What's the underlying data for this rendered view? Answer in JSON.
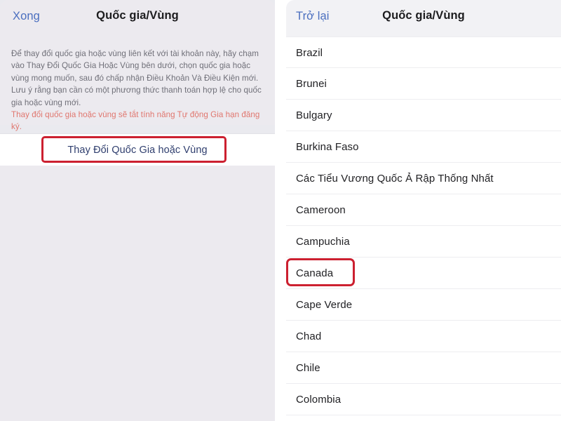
{
  "left_panel": {
    "header": {
      "done_label": "Xong",
      "title": "Quốc gia/Vùng"
    },
    "description": "Để thay đổi quốc gia hoặc vùng liên kết với tài khoản này, hãy chạm vào Thay Đổi Quốc Gia Hoặc Vùng bên dưới, chọn quốc gia hoặc vùng mong muốn, sau đó chấp nhận Điều Khoản Và Điều Kiện mới. Lưu ý rằng bạn cần có một phương thức thanh toán hợp lệ cho quốc gia hoặc vùng mới.",
    "warning": "Thay đổi quốc gia hoặc vùng sẽ tắt tính năng Tự động Gia hạn đăng ký.",
    "change_button_label": "Thay Đổi Quốc Gia hoặc Vùng",
    "highlight_color": "#cc2030",
    "warning_color": "#e0766e",
    "link_color": "#4b6fbf",
    "background_color": "#eceaef"
  },
  "right_panel": {
    "header": {
      "back_label": "Trở lại",
      "title": "Quốc gia/Vùng"
    },
    "highlighted_item": "Canada",
    "highlight_color": "#cc2030",
    "countries": [
      "Brazil",
      "Brunei",
      "Bulgary",
      "Burkina Faso",
      "Các Tiểu Vương Quốc Ả Rập Thống Nhất",
      "Cameroon",
      "Campuchia",
      "Canada",
      "Cape Verde",
      "Chad",
      "Chile",
      "Colombia"
    ]
  }
}
